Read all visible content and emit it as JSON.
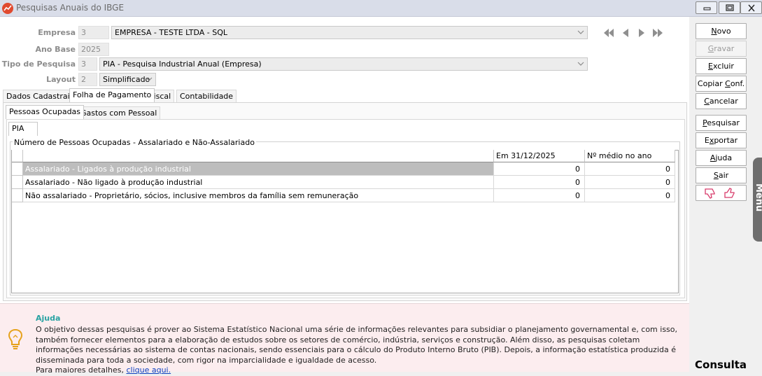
{
  "window": {
    "title": "Pesquisas Anuais do IBGE"
  },
  "form": {
    "empresa": {
      "label": "Empresa",
      "code": "3",
      "value": "EMPRESA - TESTE LTDA - SQL"
    },
    "ano_base": {
      "label": "Ano Base",
      "value": "2025"
    },
    "tipo_pesquisa": {
      "label": "Tipo de Pesquisa",
      "code": "3",
      "value": "PIA - Pesquisa Industrial Anual (Empresa)"
    },
    "layout": {
      "label": "Layout",
      "code": "2",
      "value": "Simplificado"
    }
  },
  "tabs": [
    {
      "label": "Dados Cadastrais"
    },
    {
      "label": "Folha de Pagamento"
    },
    {
      "label": "Fiscal"
    },
    {
      "label": "Contabilidade"
    }
  ],
  "subtabs": [
    {
      "label": "Pessoas Ocupadas"
    },
    {
      "label": "Gastos com Pessoal"
    }
  ],
  "inner_tab": {
    "label": "PIA"
  },
  "group": {
    "title": "Número de Pessoas Ocupadas - Assalariado e Não-Assalariado"
  },
  "grid": {
    "headers": [
      "",
      "Em 31/12/2025",
      "Nº médio no ano"
    ],
    "rows": [
      {
        "desc": "Assalariado - Ligados à produção industrial",
        "em": "0",
        "medio": "0"
      },
      {
        "desc": "Assalariado - Não ligado à produção industrial",
        "em": "0",
        "medio": "0"
      },
      {
        "desc": "Não assalariado - Proprietário, sócios, inclusive membros da família sem remuneração",
        "em": "0",
        "medio": "0"
      }
    ]
  },
  "buttons": {
    "novo": {
      "pre": "",
      "key": "N",
      "post": "ovo"
    },
    "gravar": {
      "pre": "",
      "key": "G",
      "post": "ravar"
    },
    "excluir": {
      "pre": "",
      "key": "E",
      "post": "xcluir"
    },
    "copiar": {
      "pre": "Copiar ",
      "key": "C",
      "post": "onf."
    },
    "cancelar": {
      "pre": "",
      "key": "C",
      "post": "ancelar"
    },
    "pesquisar": {
      "pre": "",
      "key": "P",
      "post": "esquisar"
    },
    "exportar": {
      "pre": "E",
      "key": "x",
      "post": "portar"
    },
    "ajuda": {
      "pre": "",
      "key": "A",
      "post": "juda"
    },
    "sair": {
      "pre": "",
      "key": "S",
      "post": "air"
    }
  },
  "side_menu": {
    "label": "Menu"
  },
  "status": {
    "mode": "Consulta"
  },
  "help": {
    "title": "Ajuda",
    "text": "O objetivo dessas pesquisas é prover ao Sistema Estatístico Nacional uma série de informações relevantes para subsidiar o planejamento governamental e, com isso, também fornecer elementos para a elaboração de estudos sobre os setores de comércio, indústria, serviços e construção. Além disso, as pesquisas coletam informações necessárias ao sistema de contas nacionais, sendo essenciais para o cálculo do Produto Interno Bruto (PIB). Depois, a informação estatística produzida é disseminada para toda a sociedade, com rigor na imparcialidade e igualdade de acesso.",
    "more_prefix": "Para maiores detalhes, ",
    "link_text": "clique aqui."
  },
  "colors": {
    "highlight_row": "#bdbdbd",
    "help_background": "#fcedef",
    "help_title": "#2aa3a3",
    "link": "#0b3fbf"
  },
  "icons": {
    "app": "chart-icon",
    "nav": [
      "first-record-icon",
      "previous-record-icon",
      "next-record-icon",
      "last-record-icon"
    ],
    "feedback": [
      "thumbs-down-icon",
      "thumbs-up-icon"
    ],
    "help": "lightbulb-icon"
  }
}
